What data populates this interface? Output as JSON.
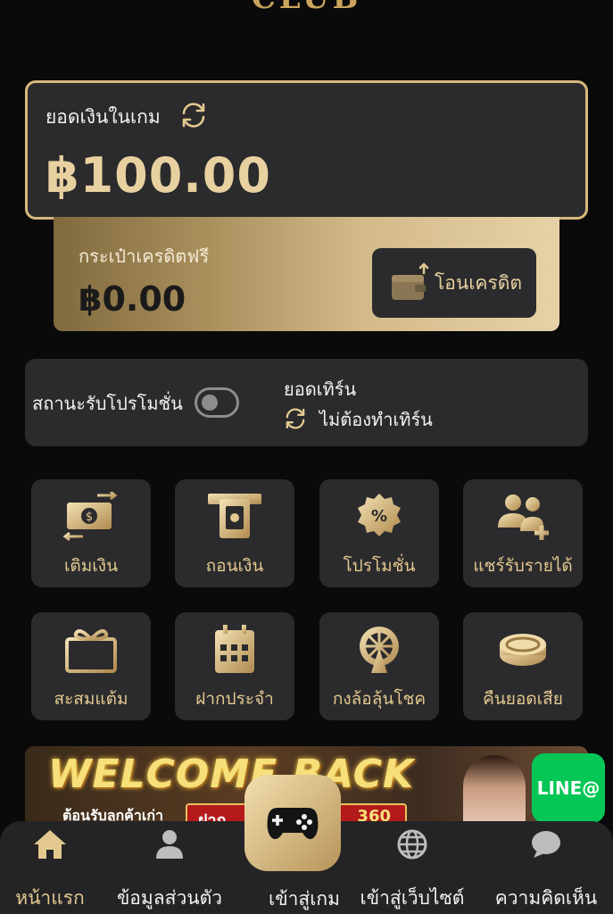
{
  "header": {
    "logo_text": "CLUB"
  },
  "balance": {
    "label": "ยอดเงินในเกม",
    "value": "฿100.00"
  },
  "free_credit": {
    "label": "กระเป๋าเครดิตฟรี",
    "value": "฿0.00",
    "transfer_label": "โอนเครดิต"
  },
  "promotion": {
    "status_label": "สถานะรับโปรโมชั่น",
    "toggle_state": "off",
    "turnover_title": "ยอดเทิร์น",
    "turnover_value": "ไม่ต้องทำเทิร์น"
  },
  "actions": [
    {
      "label": "เติมเงิน",
      "icon": "deposit-icon"
    },
    {
      "label": "ถอนเงิน",
      "icon": "withdraw-icon"
    },
    {
      "label": "โปรโมชั่น",
      "icon": "promotion-icon"
    },
    {
      "label": "แชร์รับรายได้",
      "icon": "share-income-icon"
    },
    {
      "label": "สะสมแต้ม",
      "icon": "gift-icon"
    },
    {
      "label": "ฝากประจำ",
      "icon": "calendar-icon"
    },
    {
      "label": "กงล้อลุ้นโชค",
      "icon": "lucky-wheel-icon"
    },
    {
      "label": "คืนยอดเสีย",
      "icon": "coin-cashback-icon"
    }
  ],
  "banner": {
    "title": "WELCOME BACK",
    "subtitle": "ต้อนรับลูกค้าเก่า",
    "deposit_label": "ฝาก",
    "amount": "360"
  },
  "line": {
    "label": "LINE@"
  },
  "bottom_nav": [
    {
      "label": "หน้าแรก",
      "icon": "home-icon"
    },
    {
      "label": "ข้อมูลส่วนตัว",
      "icon": "user-icon"
    },
    {
      "label": "เข้าสู่เกม",
      "icon": "gamepad-icon"
    },
    {
      "label": "เข้าสู่เว็บไซต์",
      "icon": "globe-icon"
    },
    {
      "label": "ความคิดเห็น",
      "icon": "chat-icon"
    }
  ],
  "colors": {
    "gold": "#e3c88f",
    "card": "#2b2b2d",
    "background": "#0a0a0a",
    "line_green": "#06c755"
  }
}
